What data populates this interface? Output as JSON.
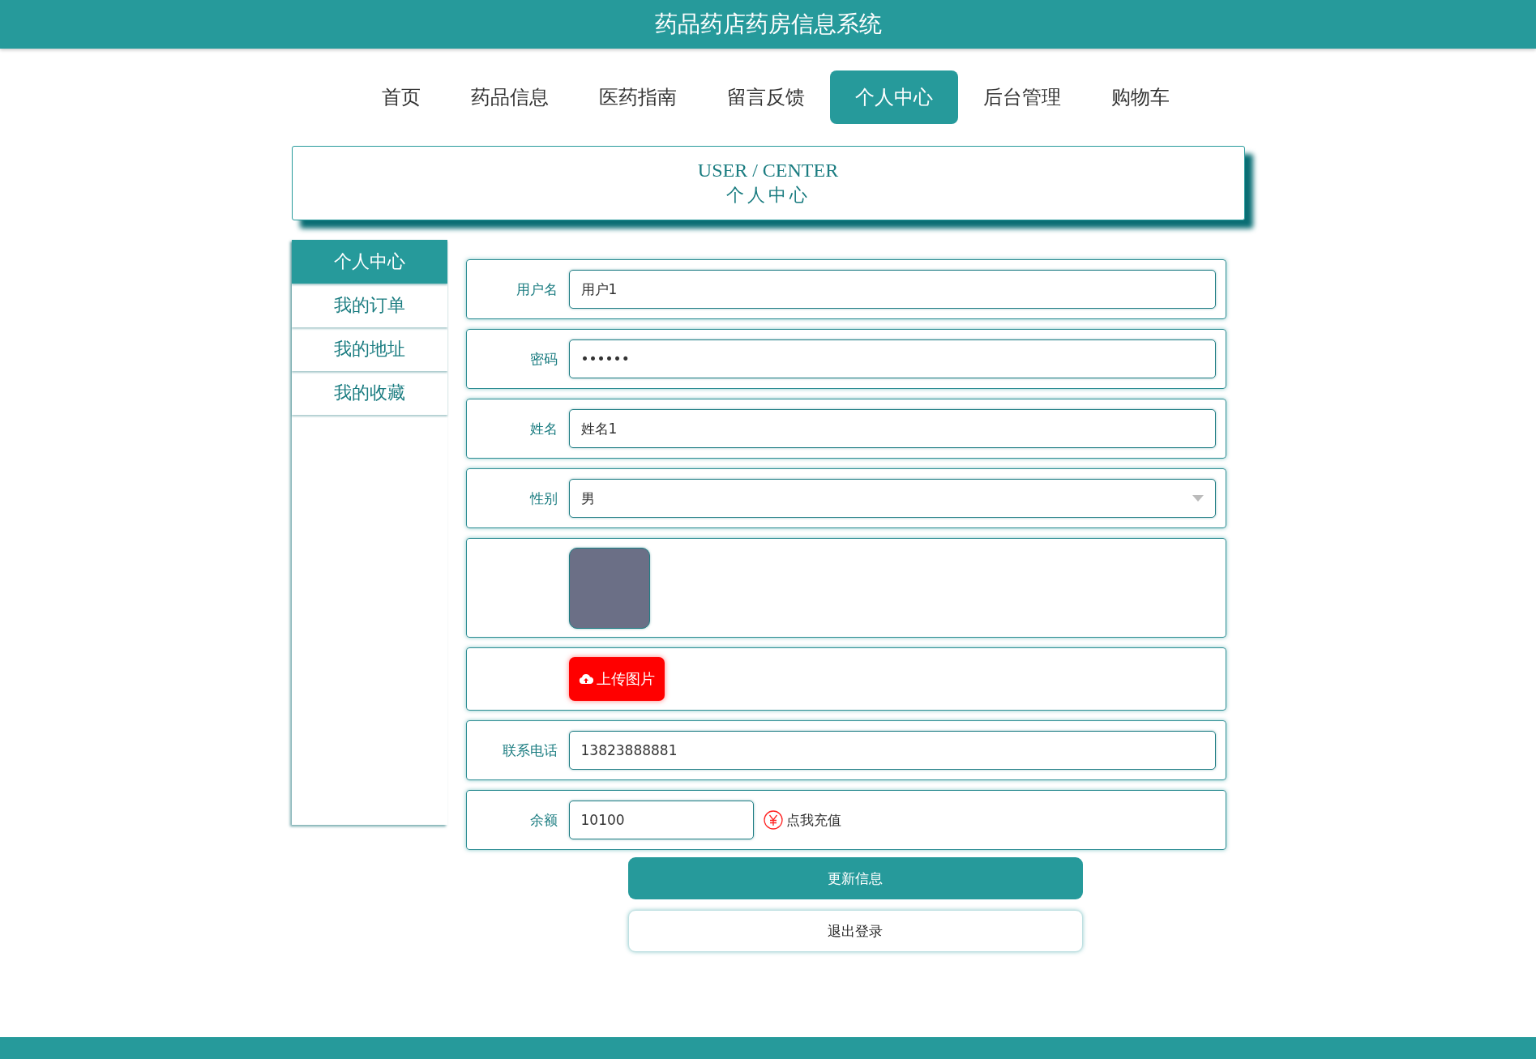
{
  "header": {
    "title": "药品药店药房信息系统"
  },
  "nav": [
    {
      "label": "首页",
      "selected": false
    },
    {
      "label": "药品信息",
      "selected": false
    },
    {
      "label": "医药指南",
      "selected": false
    },
    {
      "label": "留言反馈",
      "selected": false
    },
    {
      "label": "个人中心",
      "selected": true
    },
    {
      "label": "后台管理",
      "selected": false
    },
    {
      "label": "购物车",
      "selected": false
    }
  ],
  "title_card": {
    "english": "USER / CENTER",
    "chinese": "个人中心"
  },
  "sidebar": {
    "items": [
      {
        "label": "个人中心",
        "selected": true
      },
      {
        "label": "我的订单",
        "selected": false
      },
      {
        "label": "我的地址",
        "selected": false
      },
      {
        "label": "我的收藏",
        "selected": false
      }
    ]
  },
  "form": {
    "rows": [
      {
        "kind": "text",
        "label": "用户名",
        "value": "用户1"
      },
      {
        "kind": "password",
        "label": "密码",
        "value": "••••••"
      },
      {
        "kind": "text",
        "label": "姓名",
        "value": "姓名1"
      },
      {
        "kind": "select",
        "label": "性别",
        "value": "男"
      },
      {
        "kind": "photo"
      },
      {
        "kind": "upload",
        "button": "上传图片"
      },
      {
        "kind": "text",
        "label": "联系电话",
        "value": "13823888881"
      },
      {
        "kind": "balance",
        "label": "余额",
        "value": "10100",
        "link": "点我充值"
      }
    ],
    "buttons": [
      {
        "kind": "primary",
        "label": "更新信息"
      },
      {
        "kind": "secondary",
        "label": "退出登录"
      }
    ]
  }
}
